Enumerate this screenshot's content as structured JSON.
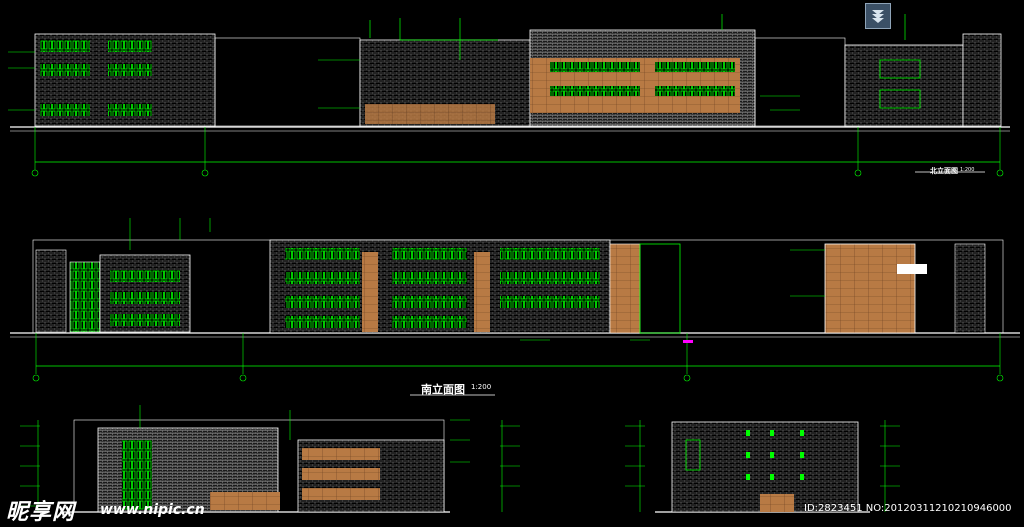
{
  "drawing": {
    "south_elevation_label": "南立面图",
    "south_elevation_scale": "1:200",
    "north_elevation_label": "北立面图",
    "north_elevation_scale": "1:200"
  },
  "toolbar": {
    "icon": "layer-stack-icon"
  },
  "watermark": {
    "logo": "昵享网",
    "url": "www.nipic.cn",
    "id_text": "ID:2823451 NO:20120311210210946000"
  },
  "colors": {
    "background": "#000000",
    "line_white": "#ffffff",
    "line_green": "#00ff00",
    "facade_brown": "#c08048",
    "dim_magenta": "#ff00ff",
    "brick_grid": "#9a9a9a"
  }
}
